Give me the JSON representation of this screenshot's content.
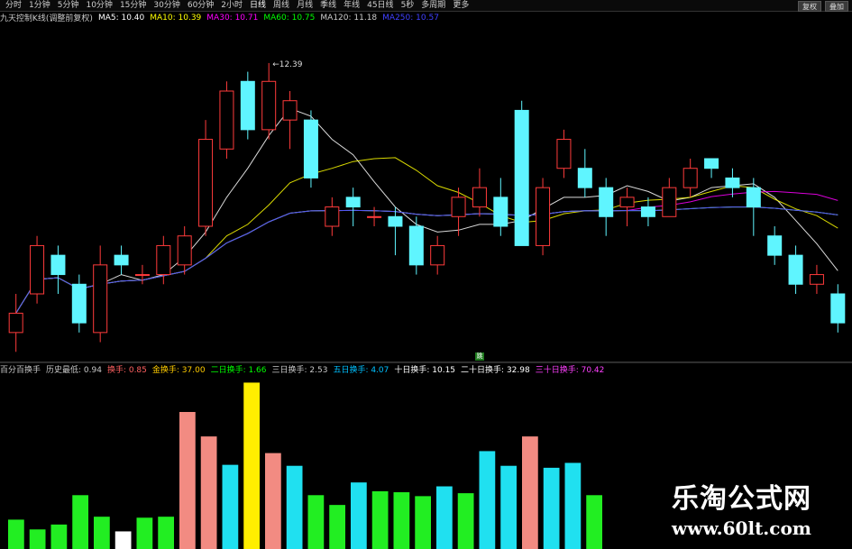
{
  "toolbar": {
    "tabs": [
      "分时",
      "1分钟",
      "5分钟",
      "10分钟",
      "15分钟",
      "30分钟",
      "60分钟",
      "2小时",
      "日线",
      "周线",
      "月线",
      "季线",
      "年线",
      "45日线",
      "5秒",
      "多周期",
      "更多"
    ],
    "active_tab": "日线",
    "right_buttons": [
      "复权",
      "叠加"
    ]
  },
  "ma_header": {
    "title": "九天控制K线(调整前复权)",
    "items": [
      {
        "label": "MA5: 10.40",
        "color": "#ffffff"
      },
      {
        "label": "MA10: 10.39",
        "color": "#ffff00"
      },
      {
        "label": "MA30: 10.71",
        "color": "#ff00ff"
      },
      {
        "label": "MA60: 10.75",
        "color": "#00ff00"
      },
      {
        "label": "MA120: 11.18",
        "color": "#cccccc"
      },
      {
        "label": "MA250: 10.57",
        "color": "#4040ff"
      }
    ]
  },
  "price_high_label": "12.39",
  "mid_marker": "跳",
  "indicator_header": {
    "items": [
      {
        "label": "百分百换手",
        "color": "#c8c8c8"
      },
      {
        "label": "历史最低: 0.94",
        "color": "#c8c8c8"
      },
      {
        "label": "换手: 0.85",
        "color": "#ff6060"
      },
      {
        "label": "金换手: 37.00",
        "color": "#ffcc00"
      },
      {
        "label": "二日换手: 1.66",
        "color": "#00ff00"
      },
      {
        "label": "三日换手: 2.53",
        "color": "#c8c8c8"
      },
      {
        "label": "五日换手: 4.07",
        "color": "#00c0ff"
      },
      {
        "label": "十日换手: 10.15",
        "color": "#ffffff"
      },
      {
        "label": "二十日换手: 32.98",
        "color": "#ffffff"
      },
      {
        "label": "三十日换手: 70.42",
        "color": "#ff40ff"
      }
    ]
  },
  "watermark": {
    "title": "乐淘公式网",
    "url": "www.60lt.com"
  },
  "colors": {
    "up": "#ff3b3b",
    "down": "#5ff5ff",
    "vol_red": "#f28b82",
    "vol_cyan": "#20e0f0",
    "vol_green": "#22ee22",
    "vol_yellow": "#ffee00",
    "vol_white": "#ffffff"
  },
  "chart_data": {
    "type": "candlestick",
    "candles": [
      {
        "o": 9.6,
        "c": 9.8,
        "h": 10.0,
        "l": 9.4,
        "up": true
      },
      {
        "o": 10.0,
        "c": 10.5,
        "h": 10.6,
        "l": 9.9,
        "up": true
      },
      {
        "o": 10.4,
        "c": 10.2,
        "h": 10.5,
        "l": 10.0,
        "up": false
      },
      {
        "o": 10.1,
        "c": 9.7,
        "h": 10.2,
        "l": 9.6,
        "up": false
      },
      {
        "o": 9.6,
        "c": 10.3,
        "h": 10.5,
        "l": 9.5,
        "up": true
      },
      {
        "o": 10.4,
        "c": 10.3,
        "h": 10.5,
        "l": 10.2,
        "up": false
      },
      {
        "o": 10.2,
        "c": 10.2,
        "h": 10.3,
        "l": 10.1,
        "up": true
      },
      {
        "o": 10.2,
        "c": 10.5,
        "h": 10.6,
        "l": 10.1,
        "up": true
      },
      {
        "o": 10.3,
        "c": 10.6,
        "h": 10.7,
        "l": 10.2,
        "up": true
      },
      {
        "o": 10.7,
        "c": 11.6,
        "h": 11.8,
        "l": 10.6,
        "up": true
      },
      {
        "o": 11.5,
        "c": 12.1,
        "h": 12.2,
        "l": 11.4,
        "up": true
      },
      {
        "o": 12.2,
        "c": 11.7,
        "h": 12.3,
        "l": 11.6,
        "up": false
      },
      {
        "o": 11.7,
        "c": 12.2,
        "h": 12.39,
        "l": 11.6,
        "up": true
      },
      {
        "o": 11.8,
        "c": 12.0,
        "h": 12.1,
        "l": 11.5,
        "up": true
      },
      {
        "o": 11.8,
        "c": 11.2,
        "h": 11.9,
        "l": 11.1,
        "up": false
      },
      {
        "o": 10.7,
        "c": 10.9,
        "h": 11.0,
        "l": 10.6,
        "up": true
      },
      {
        "o": 11.0,
        "c": 10.9,
        "h": 11.1,
        "l": 10.7,
        "up": false
      },
      {
        "o": 10.8,
        "c": 10.8,
        "h": 10.9,
        "l": 10.7,
        "up": true
      },
      {
        "o": 10.8,
        "c": 10.7,
        "h": 10.9,
        "l": 10.4,
        "up": false
      },
      {
        "o": 10.7,
        "c": 10.3,
        "h": 10.8,
        "l": 10.2,
        "up": false
      },
      {
        "o": 10.3,
        "c": 10.5,
        "h": 10.6,
        "l": 10.2,
        "up": true
      },
      {
        "o": 10.8,
        "c": 11.0,
        "h": 11.1,
        "l": 10.6,
        "up": true
      },
      {
        "o": 10.9,
        "c": 11.1,
        "h": 11.3,
        "l": 10.8,
        "up": true
      },
      {
        "o": 11.0,
        "c": 10.7,
        "h": 11.2,
        "l": 10.6,
        "up": false
      },
      {
        "o": 11.9,
        "c": 10.5,
        "h": 12.0,
        "l": 10.5,
        "up": false
      },
      {
        "o": 10.5,
        "c": 11.1,
        "h": 11.2,
        "l": 10.4,
        "up": true
      },
      {
        "o": 11.3,
        "c": 11.6,
        "h": 11.7,
        "l": 11.2,
        "up": true
      },
      {
        "o": 11.3,
        "c": 11.1,
        "h": 11.5,
        "l": 11.0,
        "up": false
      },
      {
        "o": 11.1,
        "c": 10.8,
        "h": 11.2,
        "l": 10.6,
        "up": false
      },
      {
        "o": 10.9,
        "c": 11.0,
        "h": 11.1,
        "l": 10.7,
        "up": true
      },
      {
        "o": 10.9,
        "c": 10.8,
        "h": 11.0,
        "l": 10.7,
        "up": false
      },
      {
        "o": 10.8,
        "c": 11.1,
        "h": 11.2,
        "l": 10.8,
        "up": true
      },
      {
        "o": 11.1,
        "c": 11.3,
        "h": 11.4,
        "l": 11.0,
        "up": true
      },
      {
        "o": 11.4,
        "c": 11.3,
        "h": 11.4,
        "l": 11.2,
        "up": false
      },
      {
        "o": 11.2,
        "c": 11.1,
        "h": 11.3,
        "l": 11.0,
        "up": false
      },
      {
        "o": 11.1,
        "c": 10.9,
        "h": 11.2,
        "l": 10.6,
        "up": false
      },
      {
        "o": 10.6,
        "c": 10.4,
        "h": 10.7,
        "l": 10.3,
        "up": false
      },
      {
        "o": 10.4,
        "c": 10.1,
        "h": 10.5,
        "l": 10.0,
        "up": false
      },
      {
        "o": 10.2,
        "c": 10.1,
        "h": 10.3,
        "l": 10.0,
        "up": true
      },
      {
        "o": 10.0,
        "c": 9.7,
        "h": 10.1,
        "l": 9.6,
        "up": false
      }
    ],
    "ylim": [
      9.3,
      12.8
    ],
    "volume": {
      "values": [
        3,
        2,
        2.5,
        5.5,
        3.3,
        1.8,
        3.2,
        3.3,
        14,
        11.5,
        8.6,
        17,
        9.8,
        8.5,
        5.5,
        4.5,
        6.8,
        5.9,
        5.8,
        5.4,
        6.4,
        5.7,
        10,
        8.5,
        11.5,
        8.3,
        8.8,
        5.5
      ],
      "colors": [
        "vol_green",
        "vol_green",
        "vol_green",
        "vol_green",
        "vol_green",
        "vol_white",
        "vol_green",
        "vol_green",
        "vol_red",
        "vol_red",
        "vol_cyan",
        "vol_yellow",
        "vol_red",
        "vol_cyan",
        "vol_green",
        "vol_green",
        "vol_cyan",
        "vol_green",
        "vol_green",
        "vol_green",
        "vol_cyan",
        "vol_green",
        "vol_cyan",
        "vol_cyan",
        "vol_red",
        "vol_cyan",
        "vol_cyan",
        "vol_green"
      ],
      "ylim": [
        0,
        17.5
      ]
    }
  }
}
